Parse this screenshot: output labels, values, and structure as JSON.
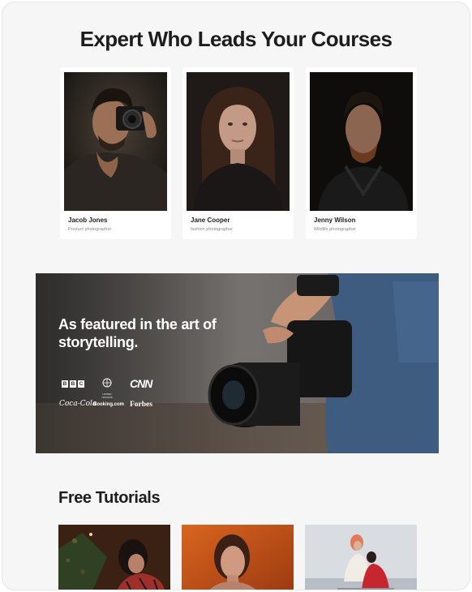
{
  "experts": {
    "title": "Expert Who Leads Your Courses",
    "cards": [
      {
        "name": "Jacob Jones",
        "role": "Product photographer"
      },
      {
        "name": "Jane Cooper",
        "role": "fashion photographer"
      },
      {
        "name": "Jenny Wilson",
        "role": "Wildlife photographer"
      }
    ]
  },
  "featured": {
    "title": "As featured in the art of storytelling.",
    "logos": {
      "bbc": [
        "B",
        "B",
        "C"
      ],
      "un": "UNITED NATIONS",
      "cnn": "CNN",
      "coke": "Coca-Cola",
      "booking": "Booking.com",
      "forbes": "Forbes"
    }
  },
  "tutorials": {
    "title": "Free Tutorials"
  },
  "colors": {
    "background": "#f6f6f6",
    "card": "#ffffff",
    "text": "#1d1d1d"
  }
}
